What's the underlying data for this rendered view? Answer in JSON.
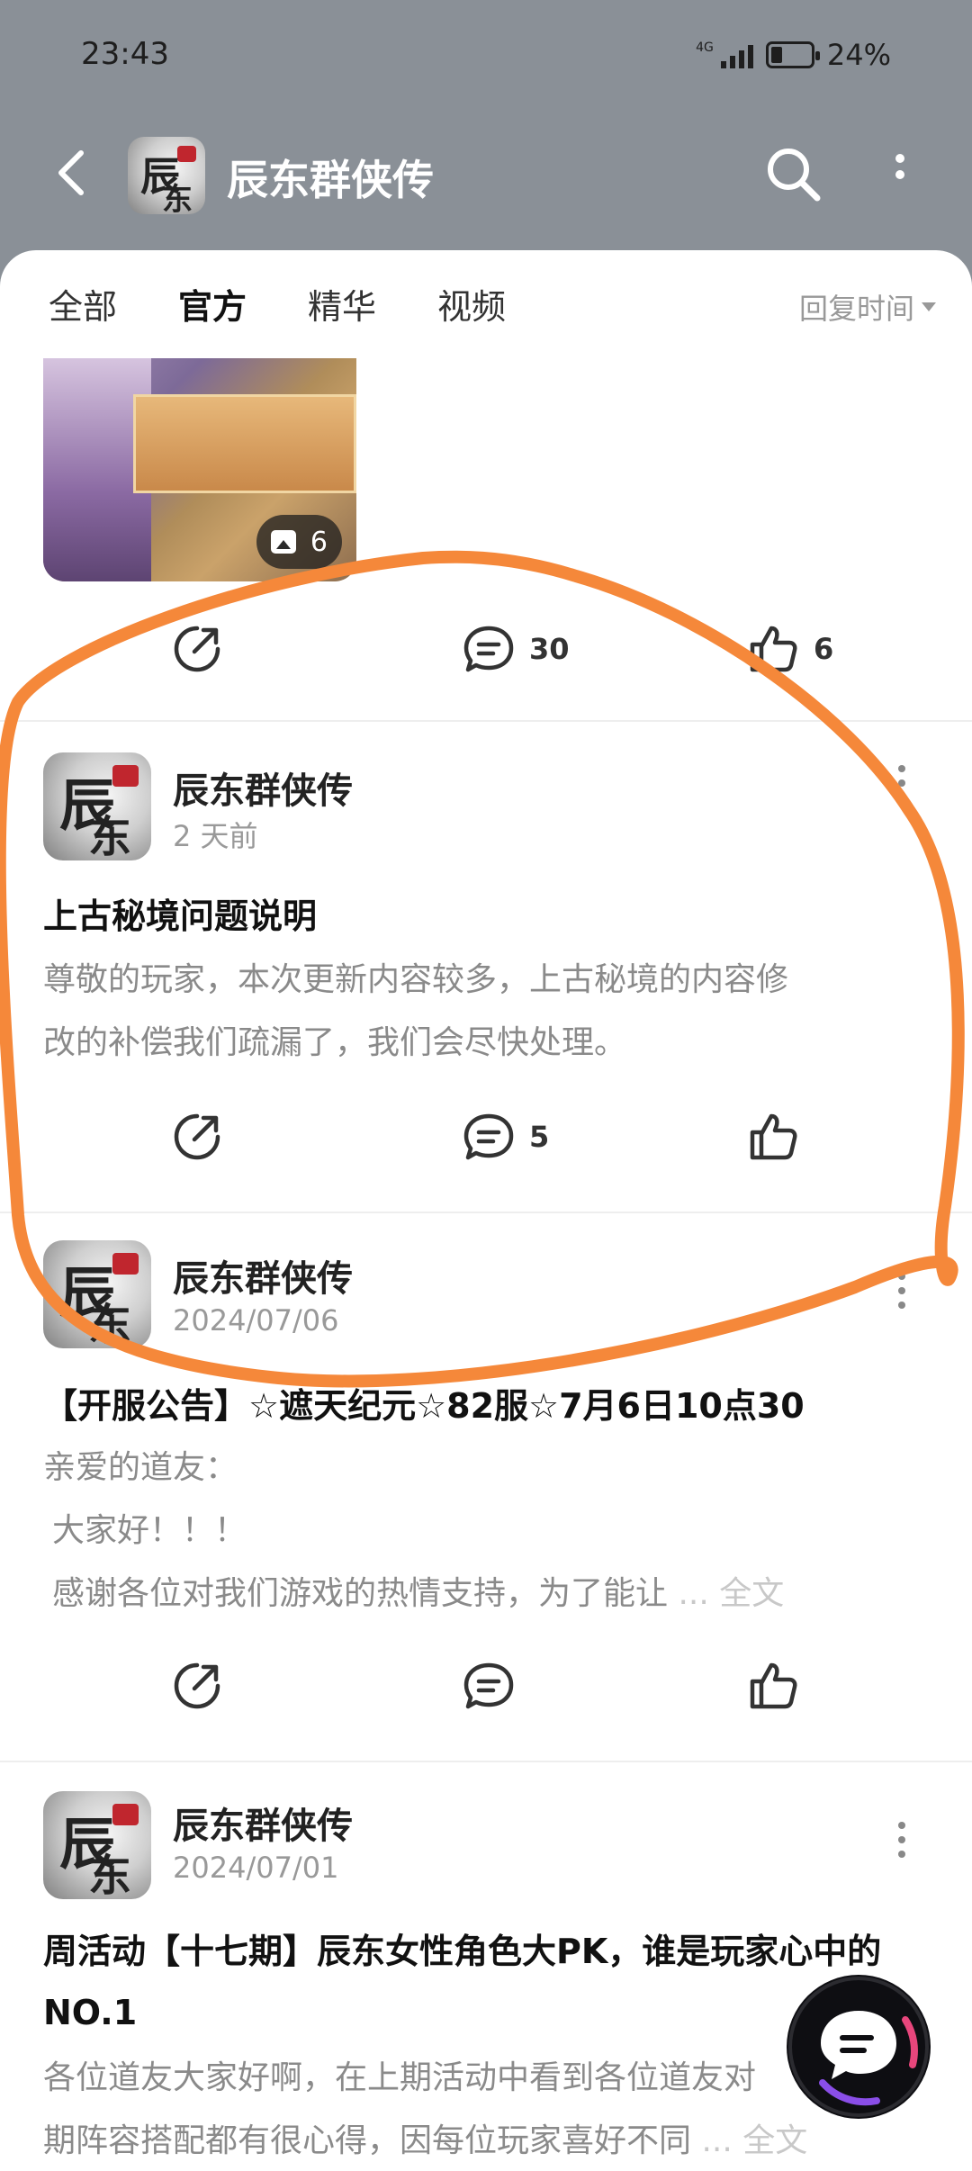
{
  "status_bar": {
    "time": "23:43",
    "network": "4G",
    "battery": "24%"
  },
  "header": {
    "title": "辰东群侠传",
    "back_icon": "back-arrow-icon",
    "search_icon": "search-icon",
    "more_icon": "more-vertical-icon"
  },
  "tabs": {
    "items": [
      "全部",
      "官方",
      "精华",
      "视频"
    ],
    "active": "官方",
    "sort_label": "回复时间"
  },
  "top_post": {
    "image_count": "6",
    "comments": "30",
    "likes": "6"
  },
  "posts": [
    {
      "author": "辰东群侠传",
      "time": "2 天前",
      "title": "上古秘境问题说明",
      "body": [
        "尊敬的玩家，本次更新内容较多，上古秘境的内容修",
        "改的补偿我们疏漏了，我们会尽快处理。"
      ],
      "comments": "5"
    },
    {
      "author": "辰东群侠传",
      "time": "2024/07/06",
      "title": "【开服公告】☆遮天纪元☆82服☆7月6日10点30",
      "body": [
        "亲爱的道友：",
        "大家好！！！",
        "感谢各位对我们游戏的热情支持，为了能让"
      ],
      "ellipsis": "...",
      "fulltext": "全文"
    },
    {
      "author": "辰东群侠传",
      "time": "2024/07/01",
      "title": "周活动【十七期】辰东女性角色大PK，谁是玩家心中的NO.1",
      "body": [
        "各位道友大家好啊，在上期活动中看到各位道友对",
        "期阵容搭配都有很心得，因每位玩家喜好不同"
      ],
      "ellipsis": "...",
      "fulltext": "全文"
    }
  ],
  "colors": {
    "accent": "#18c7c2",
    "annotation": "#f5883a",
    "header_bg": "#8a9097"
  }
}
